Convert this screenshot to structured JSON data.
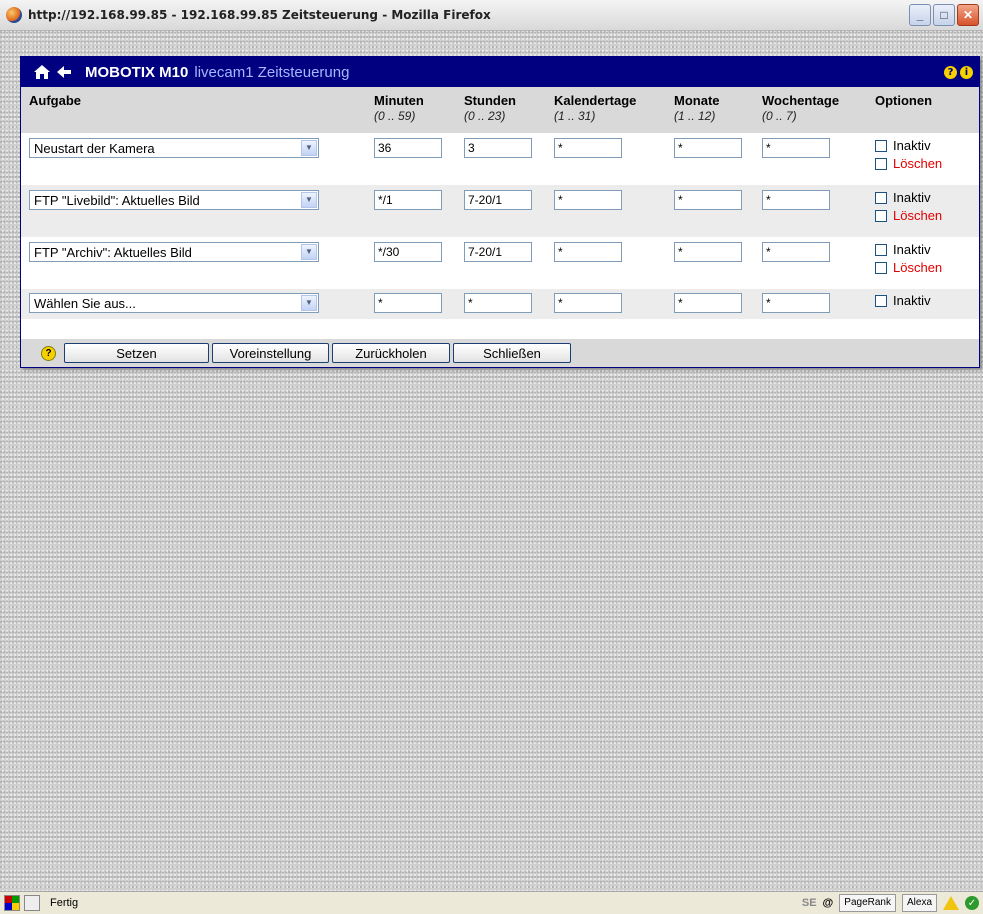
{
  "window": {
    "title": "http://192.168.99.85 - 192.168.99.85 Zeitsteuerung - Mozilla Firefox",
    "min_glyph": "_",
    "max_glyph": "□",
    "close_glyph": "✕"
  },
  "header": {
    "brand": "MOBOTIX M10",
    "page": "livecam1 Zeitsteuerung",
    "help_glyph": "?",
    "info_glyph": "i"
  },
  "table": {
    "columns": [
      {
        "label": "Aufgabe",
        "range": ""
      },
      {
        "label": "Minuten",
        "range": "(0 .. 59)"
      },
      {
        "label": "Stunden",
        "range": "(0 .. 23)"
      },
      {
        "label": "Kalendertage",
        "range": "(1 .. 31)"
      },
      {
        "label": "Monate",
        "range": "(1 .. 12)"
      },
      {
        "label": "Wochentage",
        "range": "(0 .. 7)"
      },
      {
        "label": "Optionen",
        "range": ""
      }
    ],
    "rows": [
      {
        "task": "Neustart der Kamera",
        "minutes": "36",
        "hours": "3",
        "days": "*",
        "months": "*",
        "weekdays": "*",
        "opt_inactive": "Inaktiv",
        "opt_delete": "Löschen"
      },
      {
        "task": "FTP \"Livebild\": Aktuelles Bild",
        "minutes": "*/1",
        "hours": "7-20/1",
        "days": "*",
        "months": "*",
        "weekdays": "*",
        "opt_inactive": "Inaktiv",
        "opt_delete": "Löschen"
      },
      {
        "task": "FTP \"Archiv\": Aktuelles Bild",
        "minutes": "*/30",
        "hours": "7-20/1",
        "days": "*",
        "months": "*",
        "weekdays": "*",
        "opt_inactive": "Inaktiv",
        "opt_delete": "Löschen"
      },
      {
        "task": "Wählen Sie aus...",
        "minutes": "*",
        "hours": "*",
        "days": "*",
        "months": "*",
        "weekdays": "*",
        "opt_inactive": "Inaktiv"
      }
    ]
  },
  "footer": {
    "help_glyph": "?",
    "buttons": [
      "Setzen",
      "Voreinstellung",
      "Zurückholen",
      "Schließen"
    ]
  },
  "statusbar": {
    "status": "Fertig",
    "seo": "SE",
    "pagerank": "PageRank",
    "alexa": "Alexa"
  },
  "colors": {
    "header_bg": "#000080",
    "delete_red": "#e00000"
  }
}
